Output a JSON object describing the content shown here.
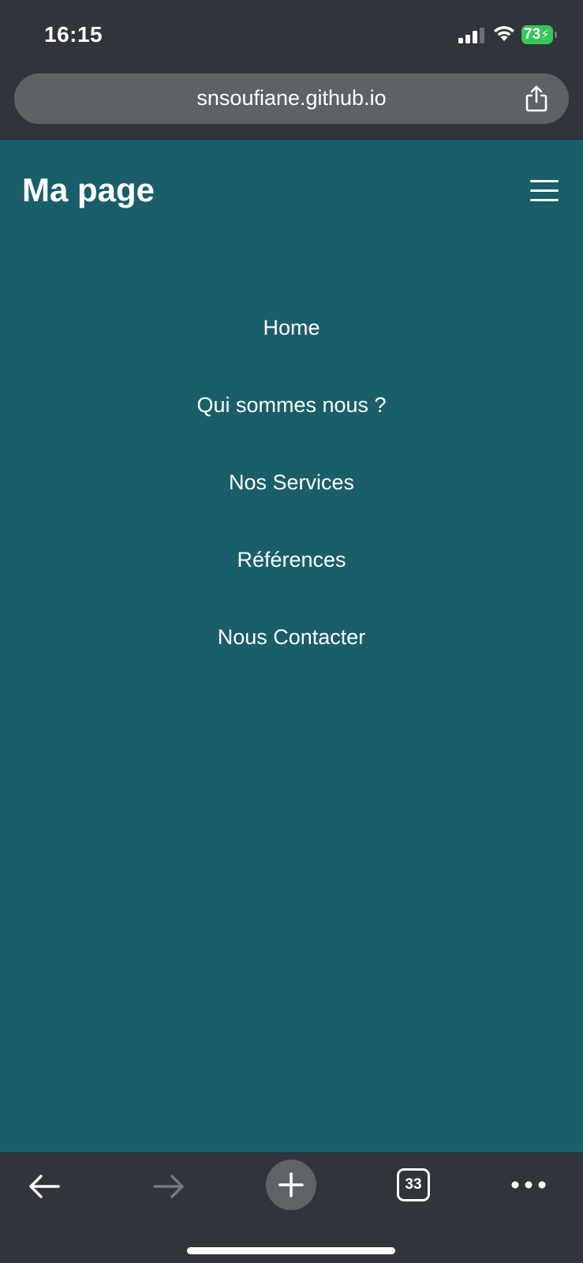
{
  "status_bar": {
    "time": "16:15",
    "battery_level": "73",
    "battery_color": "#34c759",
    "icons": [
      "signal-icon",
      "wifi-icon",
      "battery-charging-icon"
    ]
  },
  "address_bar": {
    "url": "snsoufiane.github.io",
    "share_icon": "share-icon"
  },
  "page": {
    "background_color": "#1a5e6a",
    "title": "Ma page",
    "menu_icon": "hamburger-icon",
    "nav_items": [
      {
        "label": "Home"
      },
      {
        "label": "Qui sommes nous ?"
      },
      {
        "label": "Nos Services"
      },
      {
        "label": "Références"
      },
      {
        "label": "Nous Contacter"
      }
    ]
  },
  "toolbar": {
    "back_icon": "back-arrow-icon",
    "forward_icon": "forward-arrow-icon",
    "new_tab_icon": "plus-icon",
    "tab_count": "33",
    "more_icon": "more-dots-icon"
  }
}
